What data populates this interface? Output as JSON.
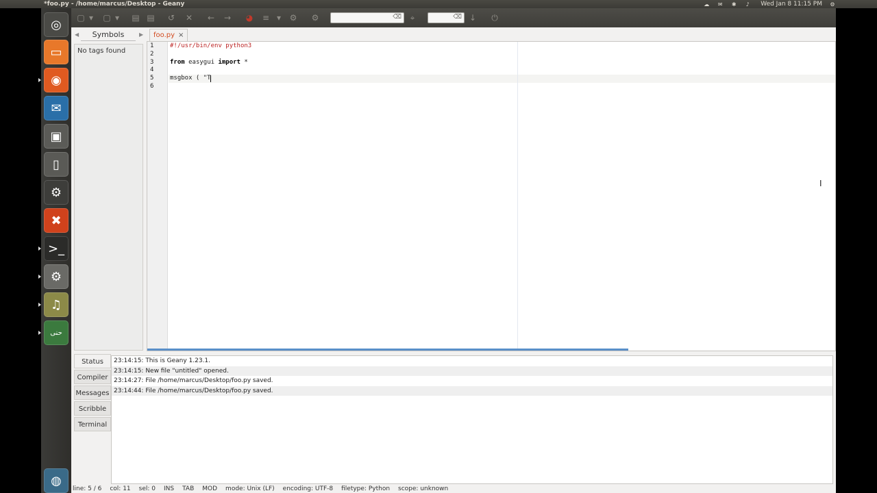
{
  "window_title": "*foo.py - /home/marcus/Desktop - Geany",
  "clock": "Wed Jan 8  11:15 PM",
  "tray_icons": [
    "cloud-icon",
    "mail-icon",
    "bluetooth-icon",
    "volume-icon",
    "gear-icon"
  ],
  "launcher": [
    "ubuntu-logo-icon",
    "files-icon",
    "firefox-icon",
    "mail-icon",
    "disk-icon",
    "document-icon",
    "steam-icon",
    "stop-icon",
    "terminal-icon",
    "settings-icon",
    "speaker-icon",
    "arabic-app-icon",
    "trash-icon"
  ],
  "launcher_arabic_label": "حنى",
  "sidebar": {
    "tab_label": "Symbols",
    "content": "No tags found"
  },
  "editor": {
    "tab_label": "foo.py",
    "close_glyph": "×",
    "line_numbers": [
      "1",
      "2",
      "3",
      "4",
      "5",
      "6"
    ],
    "lines": [
      {
        "parts": [
          {
            "t": "#!/usr/bin/env python3",
            "c": "cm"
          }
        ]
      },
      {
        "parts": []
      },
      {
        "parts": [
          {
            "t": "from",
            "c": "kw"
          },
          {
            "t": " easygui ",
            "c": ""
          },
          {
            "t": "import",
            "c": "kw"
          },
          {
            "t": " *",
            "c": ""
          }
        ]
      },
      {
        "parts": []
      },
      {
        "parts": [
          {
            "t": "msgbox ( \"T",
            "c": ""
          }
        ]
      },
      {
        "parts": []
      }
    ]
  },
  "messages": {
    "tabs": [
      "Status",
      "Compiler",
      "Messages",
      "Scribble",
      "Terminal"
    ],
    "rows": [
      "23:14:15: This is Geany 1.23.1.",
      "23:14:15: New file \"untitled\" opened.",
      "23:14:27: File /home/marcus/Desktop/foo.py saved.",
      "23:14:44: File /home/marcus/Desktop/foo.py saved."
    ]
  },
  "statusbar": {
    "line": "line: 5 / 6",
    "col": "col: 11",
    "sel": "sel: 0",
    "ins": "INS",
    "tab": "TAB",
    "mod": "MOD",
    "mode": "mode: Unix (LF)",
    "encoding": "encoding: UTF-8",
    "filetype": "filetype: Python",
    "scope": "scope: unknown"
  }
}
